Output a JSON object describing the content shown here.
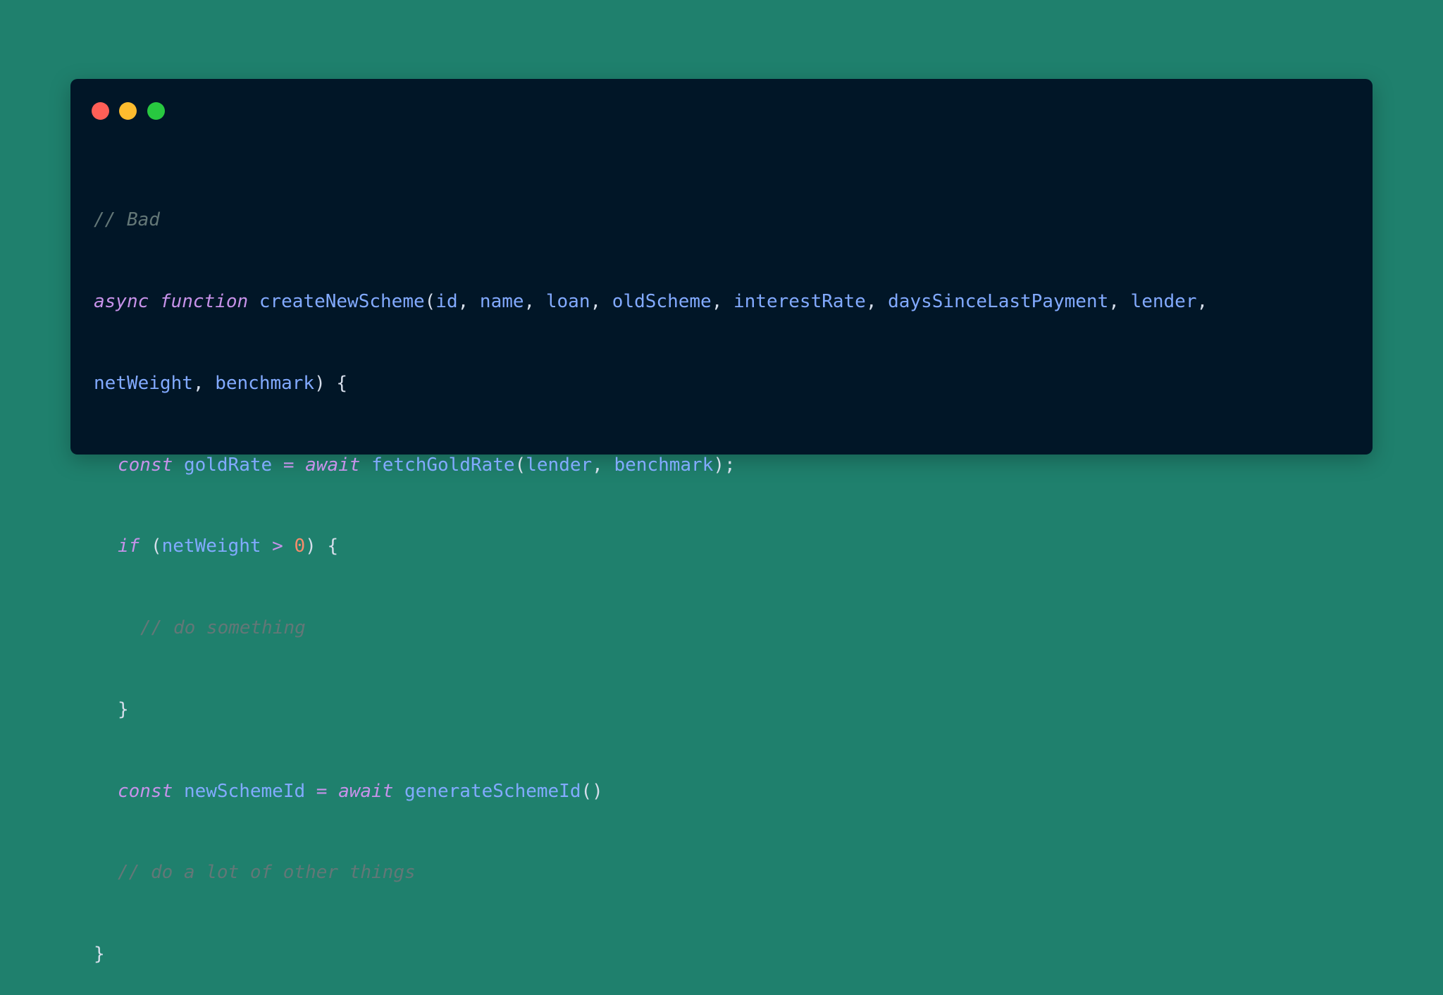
{
  "colors": {
    "background": "#1f806d",
    "window": "#011627",
    "close": "#ff5f57",
    "minimize": "#febc2e",
    "maximize": "#28c840",
    "comment": "#637777",
    "keyword": "#c792ea",
    "identifier": "#82aaff",
    "punctuation": "#d6deeb",
    "number": "#f78c6c"
  },
  "window_controls": [
    "close-icon",
    "minimize-icon",
    "maximize-icon"
  ],
  "code": {
    "l1_comment": "// Bad",
    "l2_async": "async",
    "l2_function": "function",
    "l2_name": "createNewScheme",
    "l2_open": "(",
    "l2_p1": "id",
    "l2_p2": "name",
    "l2_p3": "loan",
    "l2_p4": "oldScheme",
    "l2_p5": "interestRate",
    "l2_p6": "daysSinceLastPayment",
    "l2_p7": "lender",
    "l3_p8": "netWeight",
    "l3_p9": "benchmark",
    "l3_close": ") {",
    "l4_const": "const",
    "l4_var": "goldRate",
    "l4_eq": "=",
    "l4_await": "await",
    "l4_fn": "fetchGoldRate",
    "l4_a1": "lender",
    "l4_a2": "benchmark",
    "l4_end": ");",
    "l5_if": "if",
    "l5_open": "(",
    "l5_var": "netWeight",
    "l5_op": ">",
    "l5_num": "0",
    "l5_close": ") {",
    "l6_comment": "// do something",
    "l7_brace": "}",
    "l8_const": "const",
    "l8_var": "newSchemeId",
    "l8_eq": "=",
    "l8_await": "await",
    "l8_fn": "generateSchemeId",
    "l8_parens": "()",
    "l9_comment": "// do a lot of other things",
    "l10_brace": "}"
  }
}
